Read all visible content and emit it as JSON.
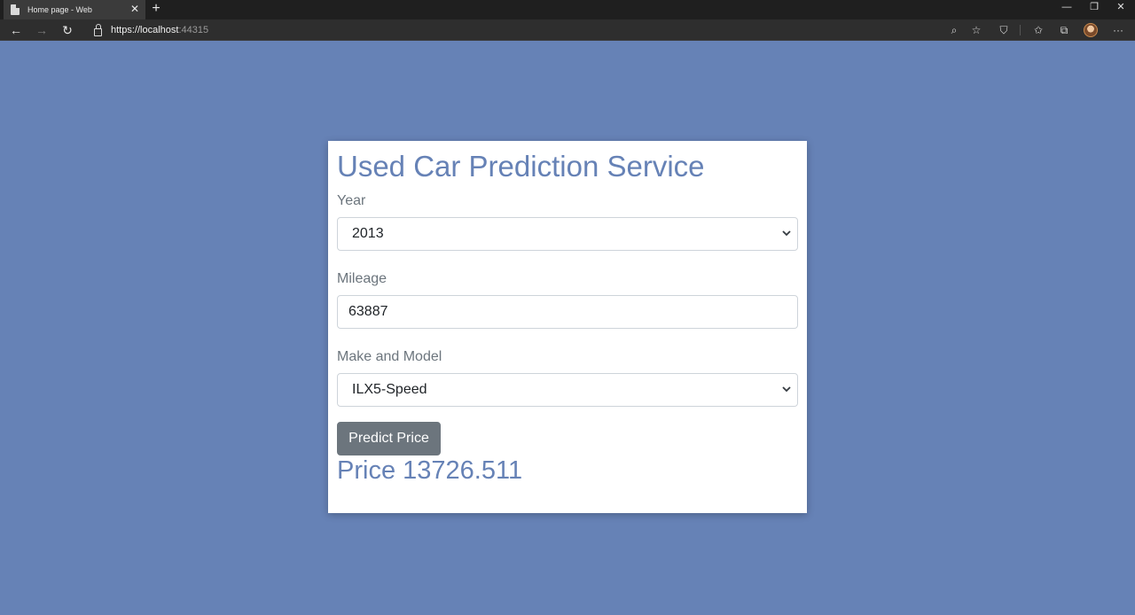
{
  "browser": {
    "tab_title": "Home page - Web",
    "url_host": "https://localhost",
    "url_port": ":44315"
  },
  "page": {
    "title": "Used Car Prediction Service",
    "year": {
      "label": "Year",
      "selected": "2013"
    },
    "mileage": {
      "label": "Mileage",
      "value": "63887"
    },
    "make_model": {
      "label": "Make and Model",
      "selected": "ILX5-Speed"
    },
    "predict_button": "Predict Price",
    "price_label": "Price",
    "price_value": "13726.511"
  },
  "colors": {
    "background": "#6682b6",
    "accent": "#6682b6",
    "button": "#6c757d"
  }
}
